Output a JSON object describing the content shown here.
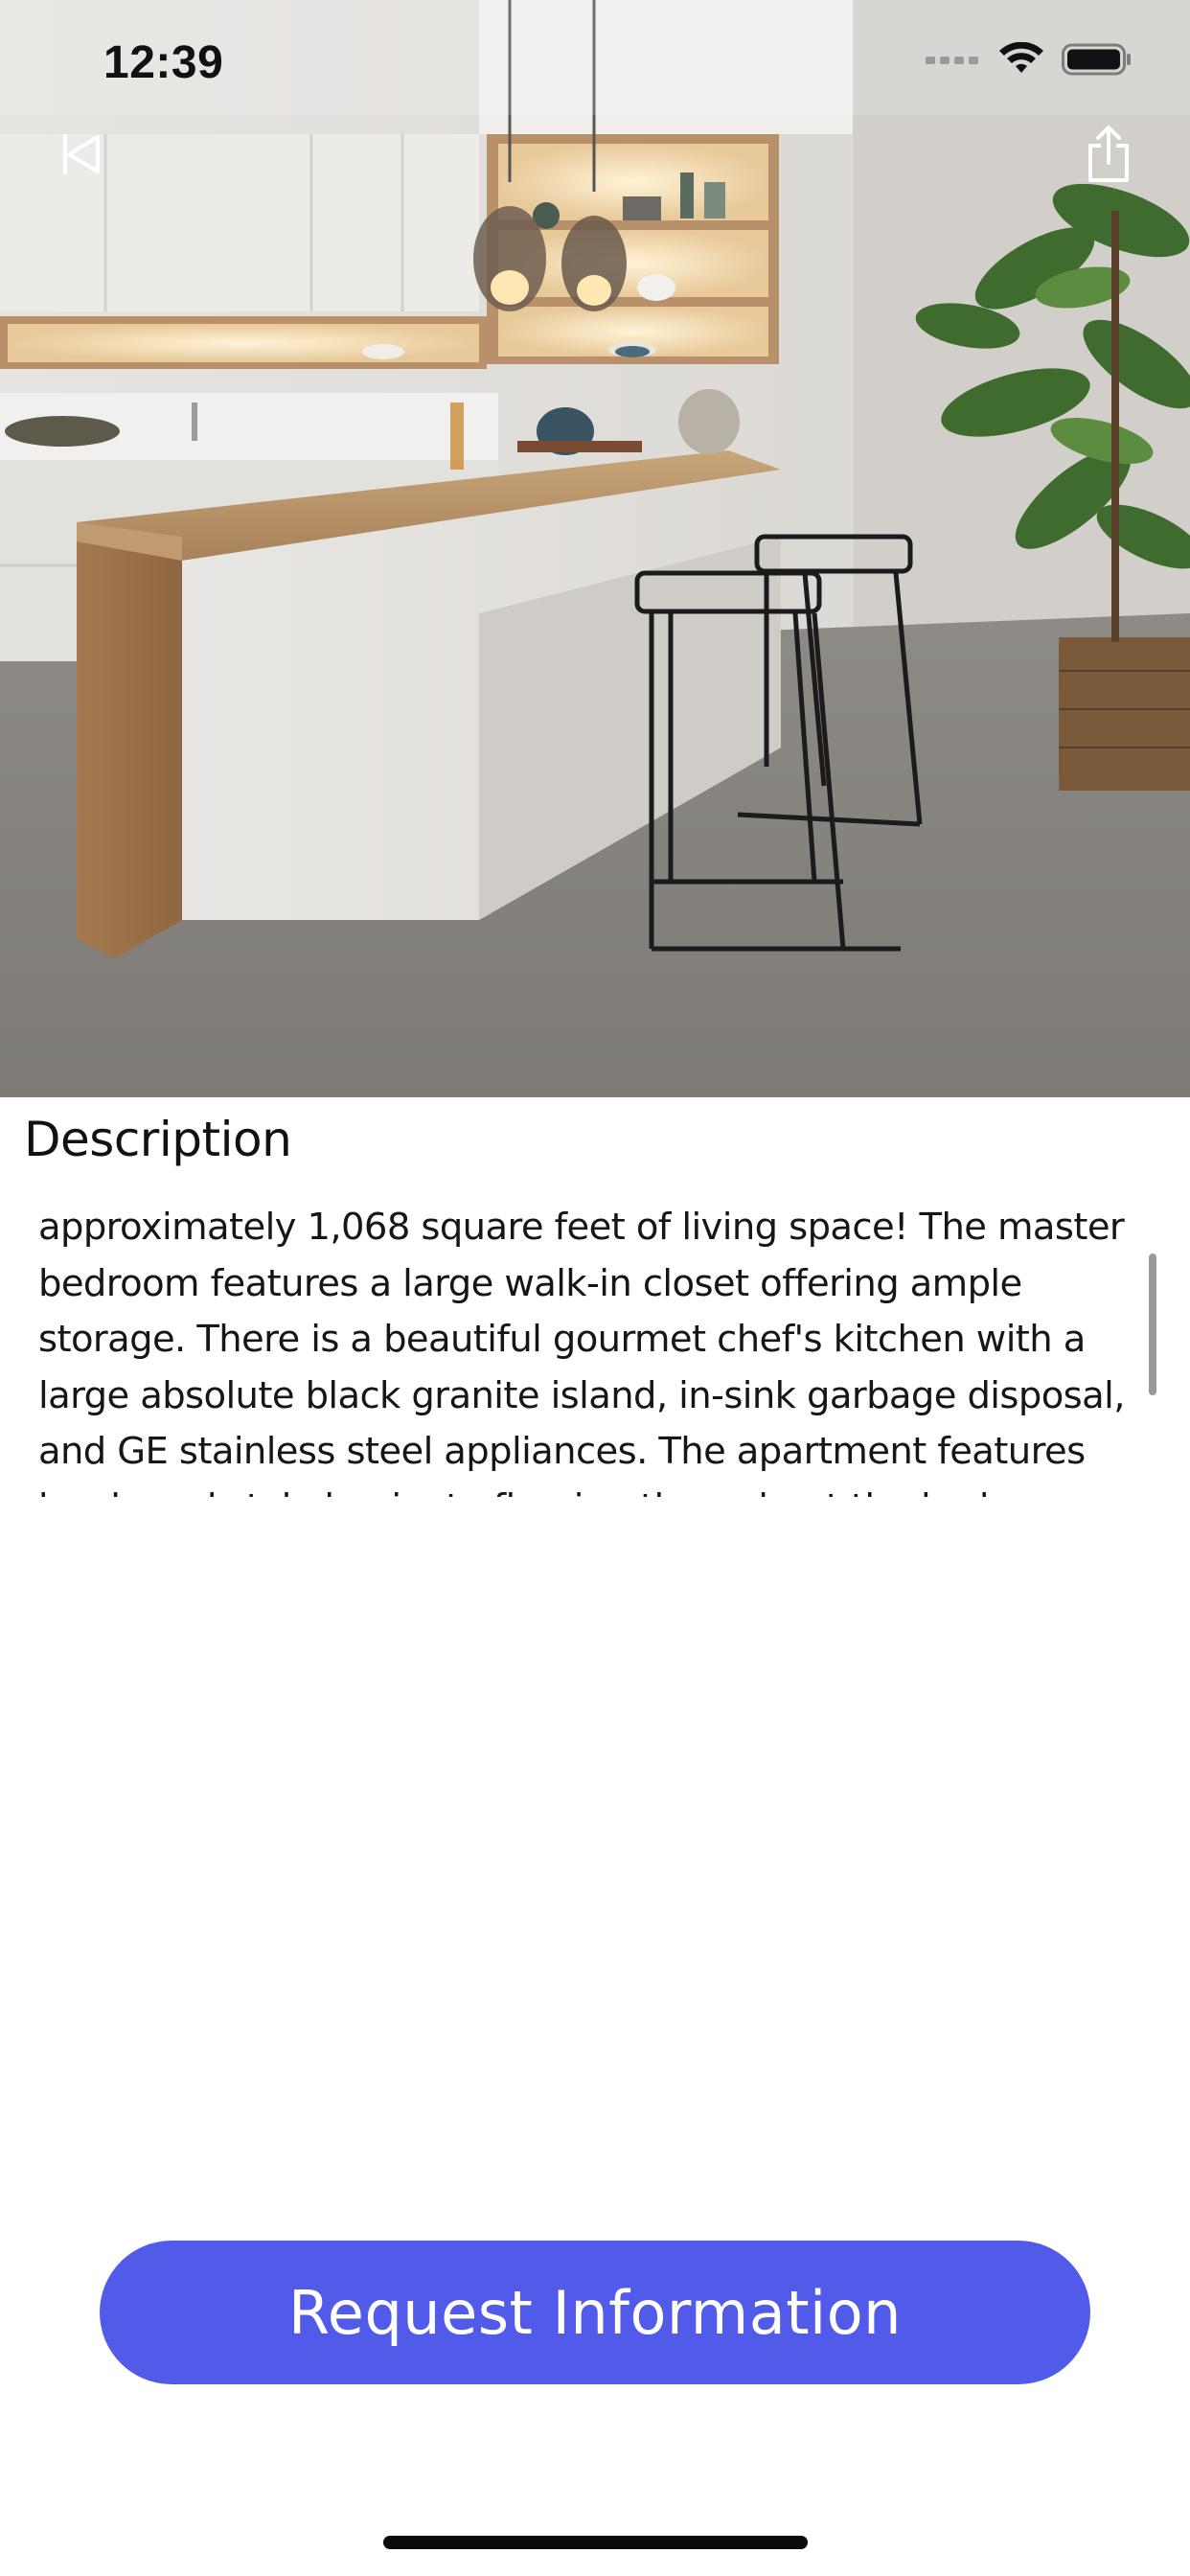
{
  "status_bar": {
    "time": "12:39"
  },
  "hero": {
    "image_description_icon": "kitchen-photo"
  },
  "nav": {
    "back_icon": "back-icon",
    "share_icon": "share-icon"
  },
  "description": {
    "title": "Description",
    "body": "approximately 1,068 square feet of living space! The master bedroom features a large walk-in closet offering ample storage. There is a beautiful gourmet chef's kitchen with a large absolute black granite island, in-sink garbage disposal, and GE stainless steel appliances. The apartment features hardwood style laminate flooring throughout the bedrooms"
  },
  "actions": {
    "request_label": "Request Information"
  },
  "colors": {
    "accent": "#525ae9"
  }
}
